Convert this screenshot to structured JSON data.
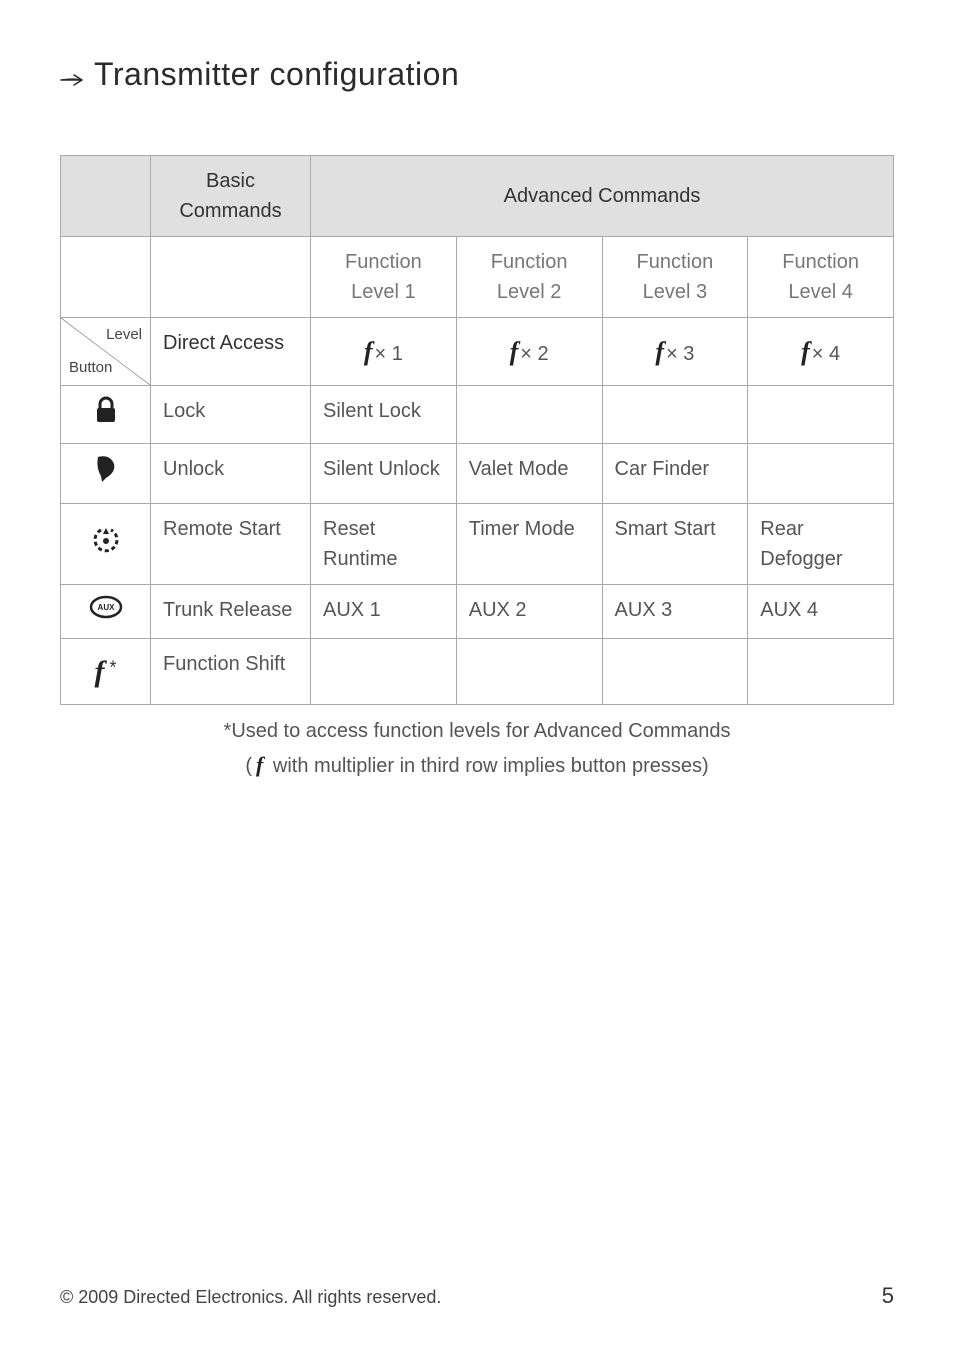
{
  "heading": "Transmitter configuration",
  "table": {
    "header_basic": "Basic Commands",
    "header_advanced": "Advanced Commands",
    "subheaders": [
      "Function Level 1",
      "Function Level 2",
      "Function Level 3",
      "Function Level 4"
    ],
    "corner_top": "Level",
    "corner_bottom": "Button",
    "direct_access": "Direct Access",
    "multipliers": [
      "× 1",
      "× 2",
      "× 3",
      "× 4"
    ],
    "rows": [
      {
        "icon": "lock",
        "basic": "Lock",
        "l1": "Silent Lock",
        "l2": "",
        "l3": "",
        "l4": ""
      },
      {
        "icon": "unlock",
        "basic": "Unlock",
        "l1": "Silent Unlock",
        "l2": "Valet Mode",
        "l3": "Car Finder",
        "l4": ""
      },
      {
        "icon": "remote",
        "basic": "Remote Start",
        "l1": "Reset Runtime",
        "l2": "Timer Mode",
        "l3": "Smart Start",
        "l4": "Rear Defogger"
      },
      {
        "icon": "aux",
        "basic": "Trunk Release",
        "l1": "AUX 1",
        "l2": "AUX 2",
        "l3": "AUX 3",
        "l4": "AUX 4"
      },
      {
        "icon": "fstar",
        "basic": "Function Shift",
        "l1": "",
        "l2": "",
        "l3": "",
        "l4": ""
      }
    ]
  },
  "footnote1": "*Used to access function levels for Advanced Commands",
  "footnote2a": "(",
  "footnote2b": " with multiplier in third row implies button presses)",
  "footer_copyright": "© 2009 Directed Electronics. All rights reserved.",
  "page_number": "5"
}
